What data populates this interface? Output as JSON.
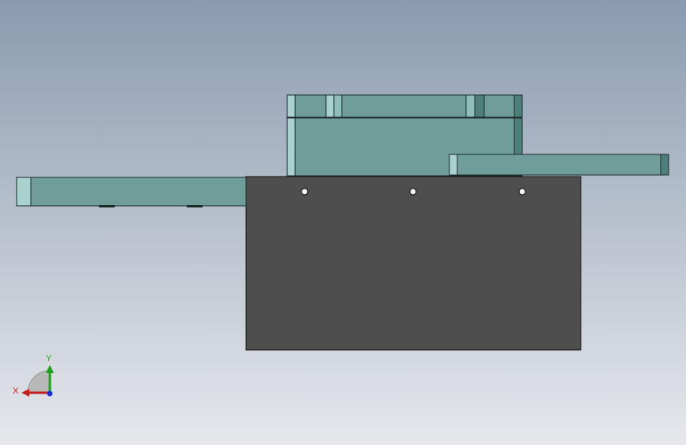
{
  "view": {
    "background_top": "#8a9bb0",
    "background_bottom": "#e6e8ec"
  },
  "colors": {
    "teal_face": "#6f9e9a",
    "teal_light": "#a9d2cf",
    "teal_dark": "#4f7f7b",
    "edge": "#1c2a2a",
    "dark_body": "#4e4e4e",
    "hole": "#f3f3f3"
  },
  "triad": {
    "x_label": "X",
    "y_label": "Y",
    "x_color": "#c41f1f",
    "y_color": "#1aa31a",
    "z_color": "#1f2fd6"
  }
}
